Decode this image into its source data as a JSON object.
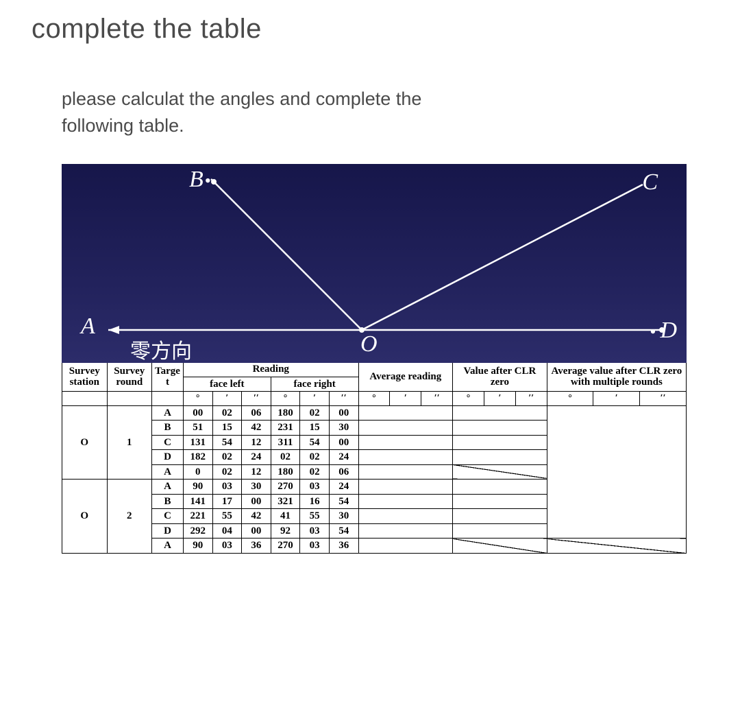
{
  "title": "complete the table",
  "instructions_line1": "please calculat the angles and complete the",
  "instructions_line2": "following table.",
  "diagram": {
    "A": "A",
    "B": "B",
    "C": "C",
    "D": "D",
    "O": "O",
    "zero_direction": "零方向",
    "B_dot": "•",
    "D_dot": "•"
  },
  "table": {
    "headers": {
      "survey_station": "Survey station",
      "survey_round": "Survey round",
      "target": "Targe t",
      "reading": "Reading",
      "face_left": "face left",
      "face_right": "face right",
      "average_reading": "Average reading",
      "value_after_clr_zero": "Value after CLR zero",
      "avg_multiple_rounds": "Average value after CLR zero with multiple rounds"
    },
    "unit_deg": "°",
    "unit_min": "′",
    "unit_sec": "′′",
    "slash": "/",
    "rows": [
      {
        "station": "O",
        "round": "1",
        "target": "A",
        "fl": [
          "00",
          "02",
          "06"
        ],
        "fr": [
          "180",
          "02",
          "00"
        ]
      },
      {
        "target": "B",
        "fl": [
          "51",
          "15",
          "42"
        ],
        "fr": [
          "231",
          "15",
          "30"
        ]
      },
      {
        "target": "C",
        "fl": [
          "131",
          "54",
          "12"
        ],
        "fr": [
          "311",
          "54",
          "00"
        ]
      },
      {
        "target": "D",
        "fl": [
          "182",
          "02",
          "24"
        ],
        "fr": [
          "02",
          "02",
          "24"
        ]
      },
      {
        "target": "A",
        "fl": [
          "0",
          "02",
          "12"
        ],
        "fr": [
          "180",
          "02",
          "06"
        ],
        "clr_slash": true
      },
      {
        "station": "O",
        "round": "2",
        "target": "A",
        "fl": [
          "90",
          "03",
          "30"
        ],
        "fr": [
          "270",
          "03",
          "24"
        ]
      },
      {
        "target": "B",
        "fl": [
          "141",
          "17",
          "00"
        ],
        "fr": [
          "321",
          "16",
          "54"
        ]
      },
      {
        "target": "C",
        "fl": [
          "221",
          "55",
          "42"
        ],
        "fr": [
          "41",
          "55",
          "30"
        ]
      },
      {
        "target": "D",
        "fl": [
          "292",
          "04",
          "00"
        ],
        "fr": [
          "92",
          "03",
          "54"
        ]
      },
      {
        "target": "A",
        "fl": [
          "90",
          "03",
          "36"
        ],
        "fr": [
          "270",
          "03",
          "36"
        ],
        "clr_slash": true,
        "fin_slash": true
      }
    ]
  }
}
